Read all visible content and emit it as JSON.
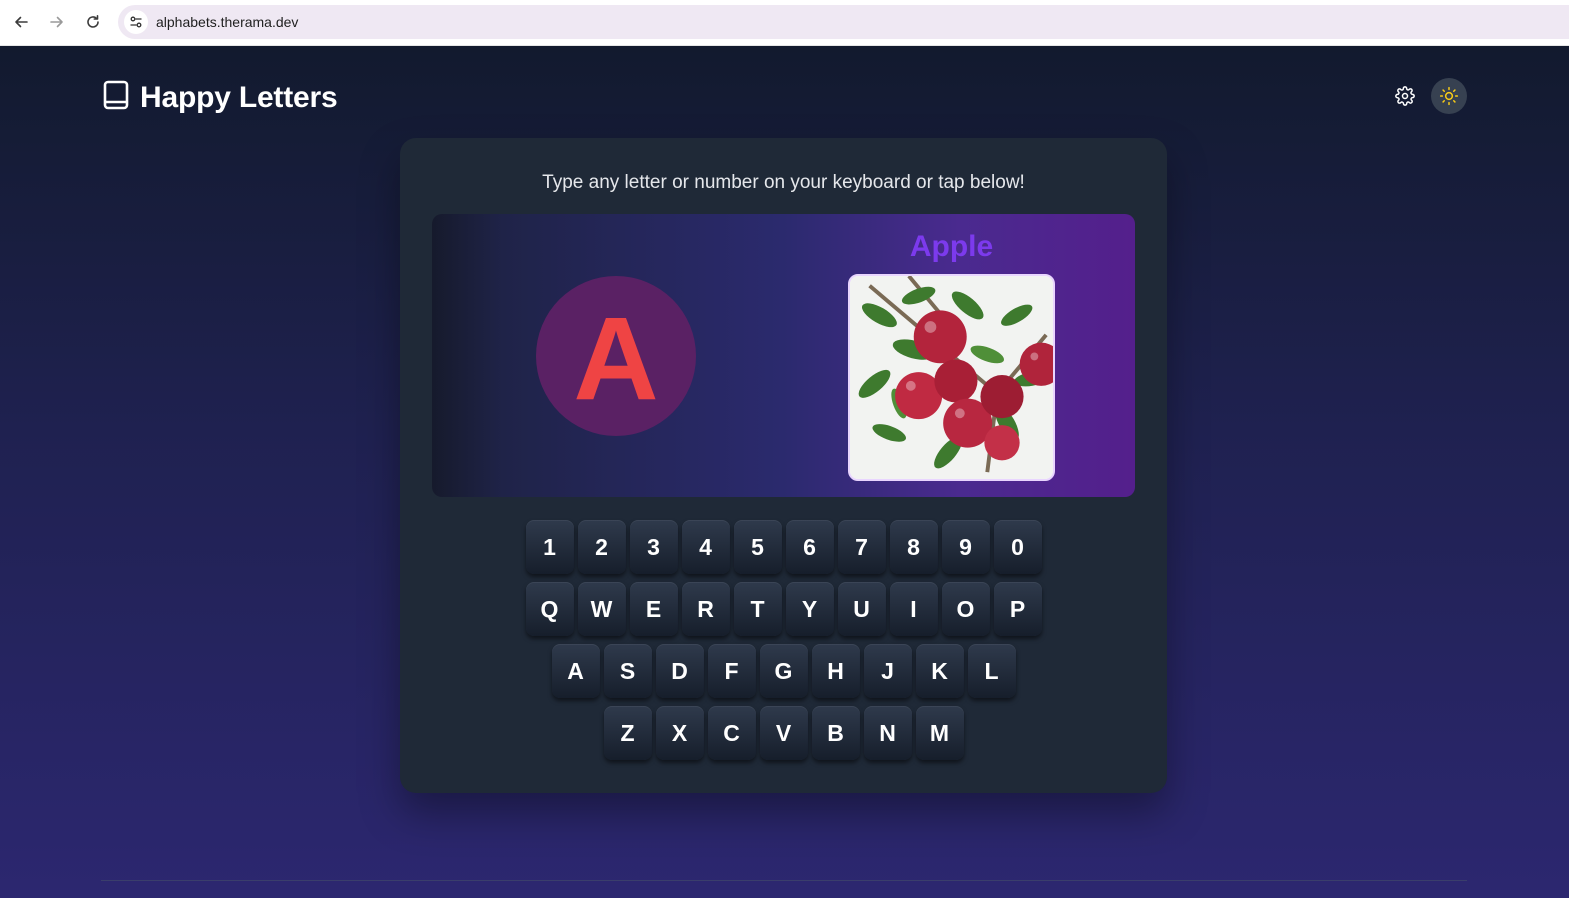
{
  "browser": {
    "url": "alphabets.therama.dev"
  },
  "app": {
    "title": "Happy Letters",
    "icons": {
      "logo": "book-icon",
      "settings": "gear-icon",
      "theme": "sun-icon"
    }
  },
  "main": {
    "instruction": "Type any letter or number on your keyboard or tap below!",
    "current_letter": "A",
    "current_word": "Apple",
    "picture": "apples-on-branch-image"
  },
  "keyboard": {
    "rows": [
      [
        "1",
        "2",
        "3",
        "4",
        "5",
        "6",
        "7",
        "8",
        "9",
        "0"
      ],
      [
        "Q",
        "W",
        "E",
        "R",
        "T",
        "Y",
        "U",
        "I",
        "O",
        "P"
      ],
      [
        "A",
        "S",
        "D",
        "F",
        "G",
        "H",
        "J",
        "K",
        "L"
      ],
      [
        "Z",
        "X",
        "C",
        "V",
        "B",
        "N",
        "M"
      ]
    ]
  },
  "colors": {
    "letter": "#ef4444",
    "word": "#7c3aed",
    "card": "#1f2937"
  }
}
